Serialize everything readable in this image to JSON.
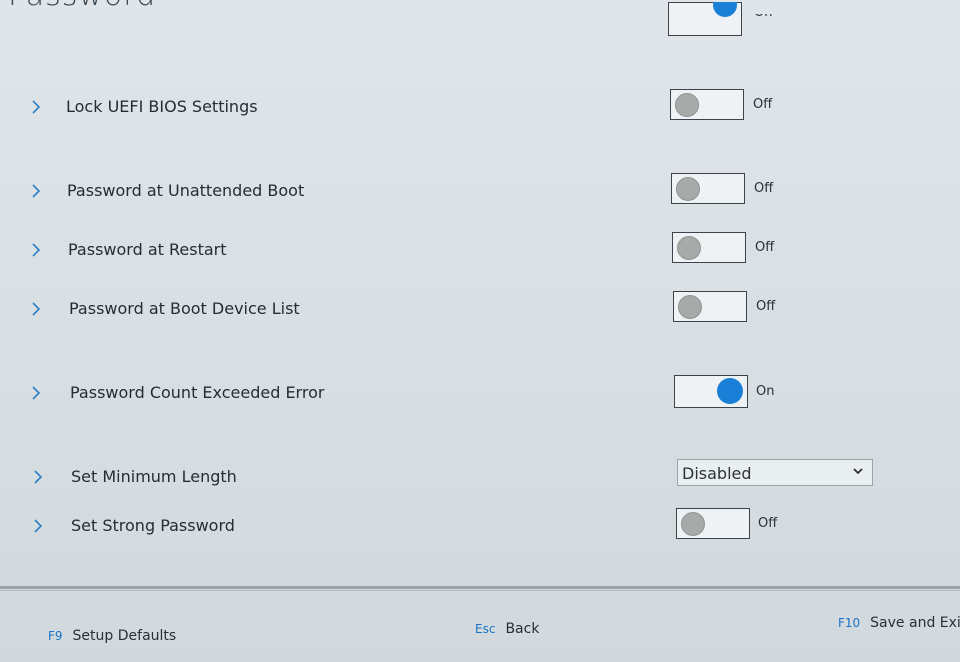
{
  "page": {
    "title": "Password"
  },
  "top_partial": {
    "state": "On"
  },
  "settings": [
    {
      "label": "Lock UEFI BIOS Settings",
      "type": "toggle",
      "value": false,
      "state": "Off"
    },
    {
      "label": "Password at Unattended Boot",
      "type": "toggle",
      "value": false,
      "state": "Off"
    },
    {
      "label": "Password at Restart",
      "type": "toggle",
      "value": false,
      "state": "Off"
    },
    {
      "label": "Password at Boot Device List",
      "type": "toggle",
      "value": false,
      "state": "Off"
    },
    {
      "label": "Password Count Exceeded Error",
      "type": "toggle",
      "value": true,
      "state": "On"
    },
    {
      "label": "Set Minimum Length",
      "type": "select",
      "value": "Disabled"
    },
    {
      "label": "Set Strong Password",
      "type": "toggle",
      "value": false,
      "state": "Off"
    }
  ],
  "footer": {
    "defaults_key": "F9",
    "defaults_label": "Setup Defaults",
    "back_key": "Esc",
    "back_label": "Back",
    "save_key": "F10",
    "save_label": "Save and Exit"
  },
  "colors": {
    "accent": "#1a7fd6",
    "knob_off": "#a7aaa9",
    "background": "#dfe5e8"
  },
  "icons": {
    "row_expand": "chevron-right-icon",
    "dropdown": "chevron-down-icon"
  }
}
